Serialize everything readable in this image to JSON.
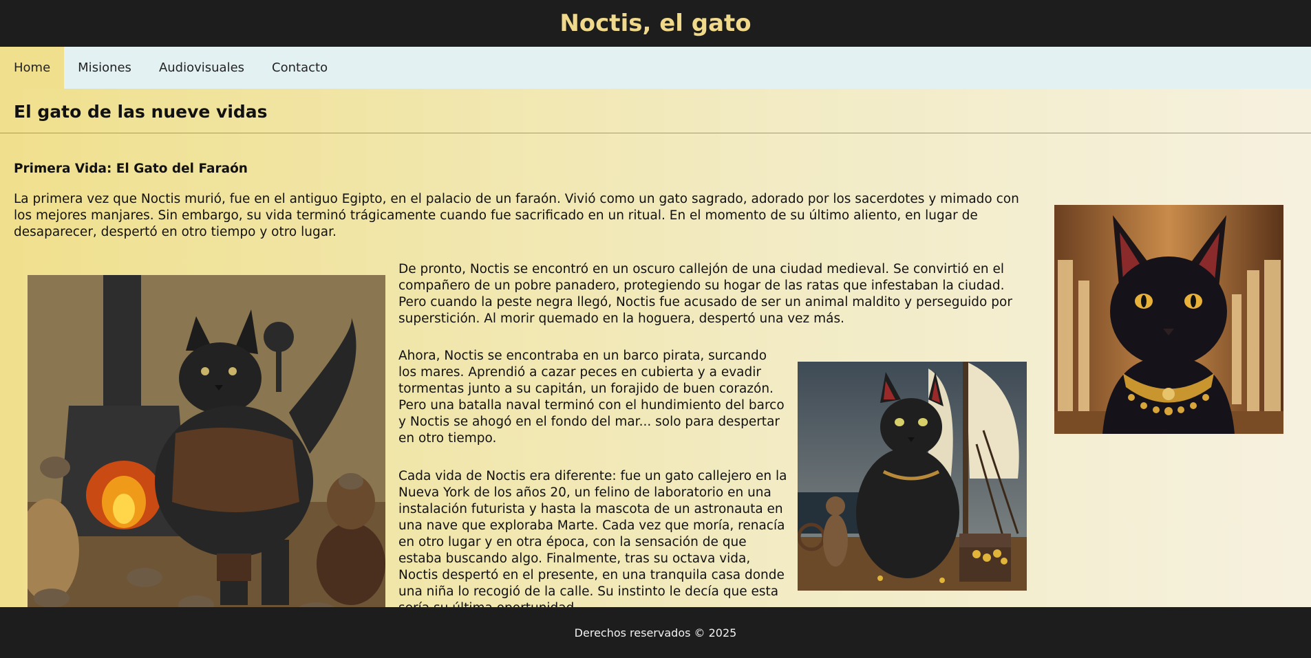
{
  "header": {
    "title": "Noctis, el gato"
  },
  "nav": {
    "items": [
      {
        "label": "Home"
      },
      {
        "label": "Misiones"
      },
      {
        "label": "Audiovisuales"
      },
      {
        "label": "Contacto"
      }
    ]
  },
  "main": {
    "section_title": "El gato de las nueve vidas",
    "subtitle": "Primera Vida: El Gato del Faraón",
    "paragraphs": [
      "La primera vez que Noctis murió, fue en el antiguo Egipto, en el palacio de un faraón. Vivió como un gato sagrado, adorado por los sacerdotes y mimado con los mejores manjares. Sin embargo, su vida terminó trágicamente cuando fue sacrificado en un ritual. En el momento de su último aliento, en lugar de desaparecer, despertó en otro tiempo y otro lugar.",
      "De pronto, Noctis se encontró en un oscuro callejón de una ciudad medieval. Se convirtió en el compañero de un pobre panadero, protegiendo su hogar de las ratas que infestaban la ciudad. Pero cuando la peste negra llegó, Noctis fue acusado de ser un animal maldito y perseguido por superstición. Al morir quemado en la hoguera, despertó una vez más.",
      "Ahora, Noctis se encontraba en un barco pirata, surcando los mares. Aprendió a cazar peces en cubierta y a evadir tormentas junto a su capitán, un forajido de buen corazón. Pero una batalla naval terminó con el hundimiento del barco y Noctis se ahogó en el fondo del mar... solo para despertar en otro tiempo.",
      "Cada vida de Noctis era diferente: fue un gato callejero en la Nueva York de los años 20, un felino de laboratorio en una instalación futurista y hasta la mascota de un astronauta en una nave que exploraba Marte. Cada vez que moría, renacía en otro lugar y en otra época, con la sensación de que estaba buscando algo. Finalmente, tras su octava vida, Noctis despertó en el presente, en una tranquila casa donde una niña lo recogió de la calle. Su instinto le decía que esta sería su última oportunidad."
    ]
  },
  "footer": {
    "text": "Derechos reservados © 2025"
  },
  "colors": {
    "header_bg": "#1d1d1d",
    "title": "#f0d98a",
    "nav_bg": "#e3f1f3",
    "nav_active": "#f0e08d"
  }
}
